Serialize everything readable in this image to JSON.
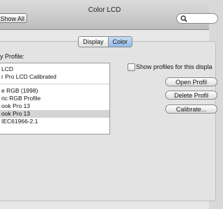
{
  "window": {
    "title": "Color LCD"
  },
  "toolbar": {
    "show_all_label": "Show All"
  },
  "search": {
    "placeholder": ""
  },
  "tabs": [
    {
      "label": "Display",
      "active": false
    },
    {
      "label": "Color",
      "active": true
    }
  ],
  "profiles": {
    "label": "y Profile:",
    "items": [
      {
        "label": "LCD",
        "selected": false
      },
      {
        "label": "r Pro LCD Calibrated",
        "selected": false
      },
      {
        "label": "e RGB (1998)",
        "selected": false
      },
      {
        "label": "ric RGB Profile",
        "selected": false
      },
      {
        "label": "ook Pro 13",
        "selected": false
      },
      {
        "label": "ook Pro 13",
        "selected": true
      },
      {
        "label": "IEC61966-2.1",
        "selected": false
      }
    ]
  },
  "options": {
    "show_all_profiles_label": "Show profiles for this displa"
  },
  "buttons": {
    "open_profile": "Open Profil",
    "delete_profile": "Delete Profil",
    "calibrate": "Calibrate..."
  }
}
